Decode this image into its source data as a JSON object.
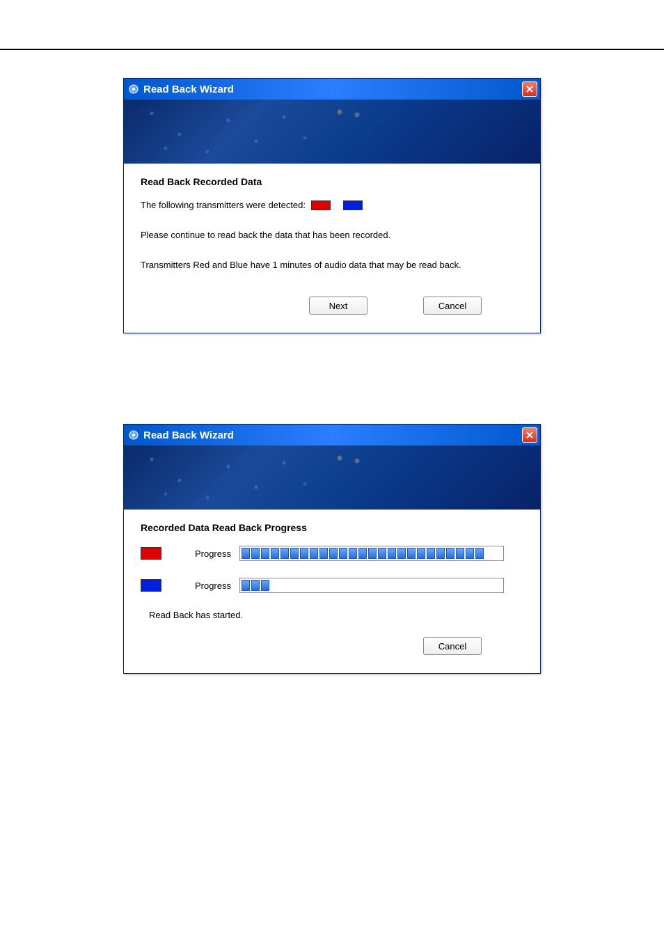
{
  "dialog1": {
    "title": "Read Back Wizard",
    "section_title": "Read Back Recorded Data",
    "detected_text": "The following transmitters were detected:",
    "swatches": [
      {
        "color": "#e00000"
      },
      {
        "color": "#0020e0"
      }
    ],
    "continue_text": "Please continue to read back the data that has been recorded.",
    "info_text": "Transmitters Red and Blue have 1 minutes of audio data that may be read back.",
    "next_label": "Next",
    "cancel_label": "Cancel"
  },
  "dialog2": {
    "title": "Read Back Wizard",
    "section_title": "Recorded Data Read Back Progress",
    "rows": [
      {
        "swatch": "#e00000",
        "label": "Progress",
        "segments": 25
      },
      {
        "swatch": "#0020e0",
        "label": "Progress",
        "segments": 3
      }
    ],
    "status_text": "Read Back has started.",
    "cancel_label": "Cancel"
  }
}
